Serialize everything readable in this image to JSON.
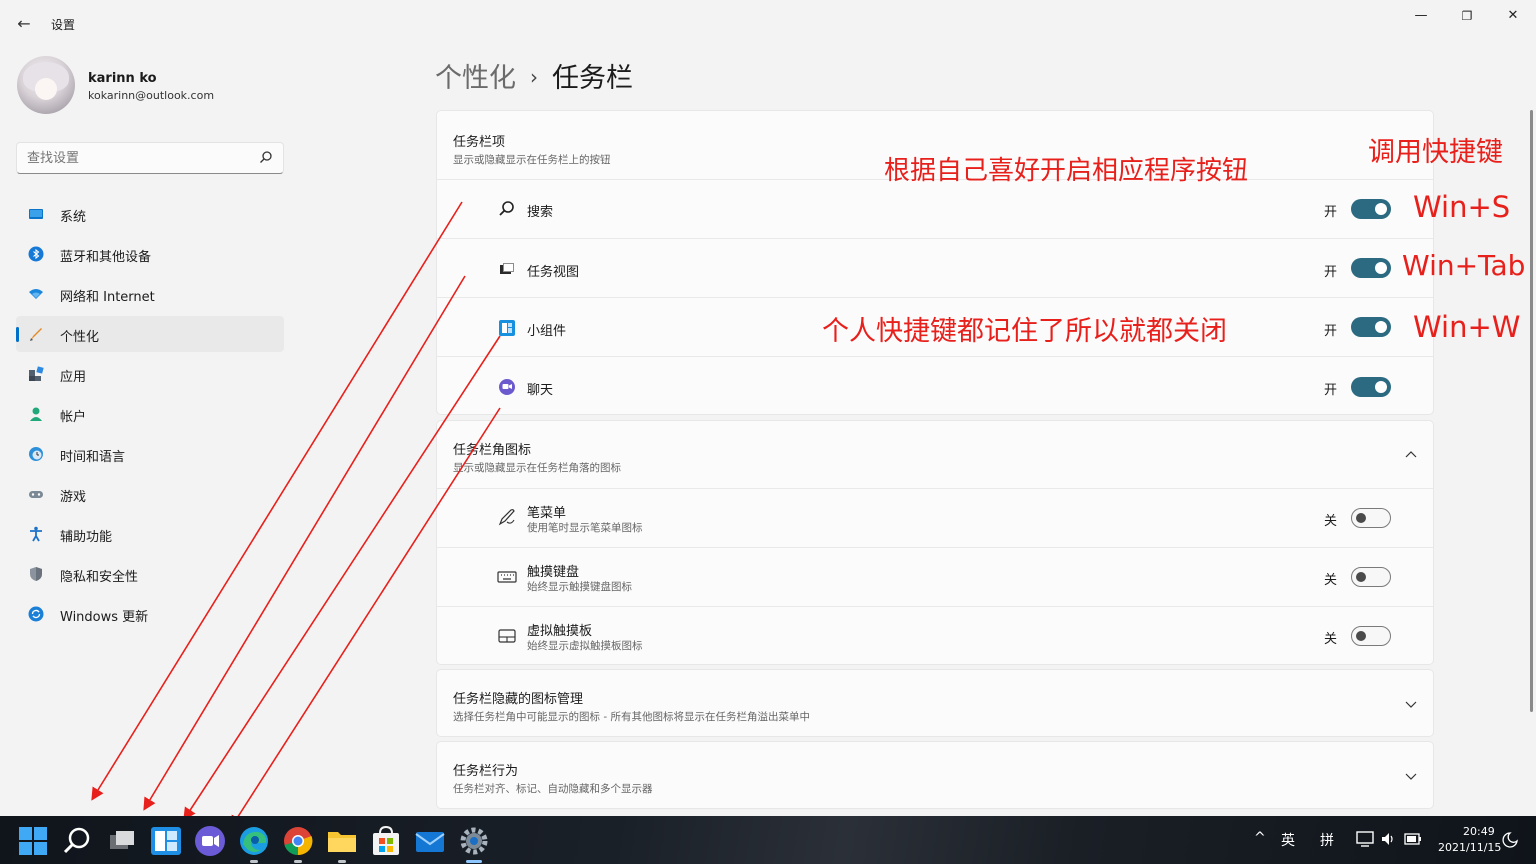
{
  "window": {
    "title": "设置",
    "back_glyph": "←",
    "minimize_glyph": "—",
    "maximize_glyph": "❐",
    "close_glyph": "✕"
  },
  "user": {
    "name": "karinn ko",
    "email": "kokarinn@outlook.com"
  },
  "search": {
    "placeholder": "查找设置",
    "icon": "search-icon"
  },
  "sidebar": {
    "items": [
      {
        "label": "系统",
        "icon": "system-icon",
        "active": false
      },
      {
        "label": "蓝牙和其他设备",
        "icon": "bluetooth-icon",
        "active": false
      },
      {
        "label": "网络和 Internet",
        "icon": "network-icon",
        "active": false
      },
      {
        "label": "个性化",
        "icon": "personalization-icon",
        "active": true
      },
      {
        "label": "应用",
        "icon": "apps-icon",
        "active": false
      },
      {
        "label": "帐户",
        "icon": "account-icon",
        "active": false
      },
      {
        "label": "时间和语言",
        "icon": "time-language-icon",
        "active": false
      },
      {
        "label": "游戏",
        "icon": "gaming-icon",
        "active": false
      },
      {
        "label": "辅助功能",
        "icon": "accessibility-icon",
        "active": false
      },
      {
        "label": "隐私和安全性",
        "icon": "privacy-icon",
        "active": false
      },
      {
        "label": "Windows 更新",
        "icon": "windows-update-icon",
        "active": false
      }
    ]
  },
  "breadcrumb": {
    "parent": "个性化",
    "separator": "›",
    "current": "任务栏"
  },
  "taskbar_items": {
    "title": "任务栏项",
    "subtitle": "显示或隐藏显示在任务栏上的按钮",
    "rows": [
      {
        "label": "搜索",
        "icon": "search-icon",
        "state": "开",
        "on": true
      },
      {
        "label": "任务视图",
        "icon": "task-view-icon",
        "state": "开",
        "on": true
      },
      {
        "label": "小组件",
        "icon": "widgets-icon",
        "state": "开",
        "on": true
      },
      {
        "label": "聊天",
        "icon": "chat-icon",
        "state": "开",
        "on": true
      }
    ]
  },
  "corner_icons": {
    "title": "任务栏角图标",
    "subtitle": "显示或隐藏显示在任务栏角落的图标",
    "expanded": true,
    "rows": [
      {
        "label": "笔菜单",
        "sub": "使用笔时显示笔菜单图标",
        "icon": "pen-icon",
        "state": "关",
        "on": false
      },
      {
        "label": "触摸键盘",
        "sub": "始终显示触摸键盘图标",
        "icon": "keyboard-icon",
        "state": "关",
        "on": false
      },
      {
        "label": "虚拟触摸板",
        "sub": "始终显示虚拟触摸板图标",
        "icon": "touchpad-icon",
        "state": "关",
        "on": false
      }
    ]
  },
  "overflow": {
    "title": "任务栏隐藏的图标管理",
    "subtitle": "选择任务栏角中可能显示的图标 - 所有其他图标将显示在任务栏角溢出菜单中"
  },
  "behaviors": {
    "title": "任务栏行为",
    "subtitle": "任务栏对齐、标记、自动隐藏和多个显示器"
  },
  "annotations": {
    "shortcut_title": "调用快捷键",
    "hint_top": "根据自己喜好开启相应程序按钮",
    "hint_mid": "个人快捷键都记住了所以就都关闭",
    "key_search": "Win+S",
    "key_taskview": "Win+Tab",
    "key_widgets": "Win+W",
    "color": "#e8201c"
  },
  "taskbar": {
    "apps": [
      "start-icon",
      "search-icon",
      "task-view-icon",
      "widgets-icon",
      "chat-icon",
      "edge-icon",
      "chrome-icon",
      "file-explorer-icon",
      "store-icon",
      "mail-icon",
      "settings-icon"
    ],
    "tray": {
      "chevron": "^",
      "ime_lang": "英",
      "ime_mode": "拼"
    },
    "time": "20:49",
    "date": "2021/11/15"
  },
  "colors": {
    "accent": "#006fc9",
    "toggle_on": "#2b6a80",
    "annotation": "#e8201c"
  }
}
